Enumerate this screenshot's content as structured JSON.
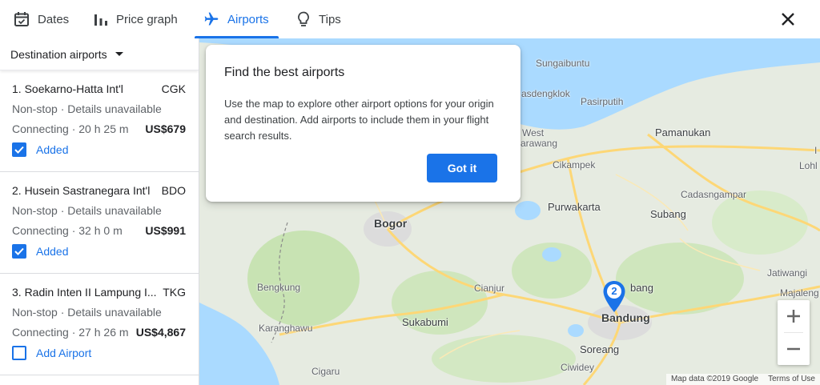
{
  "tabs": [
    {
      "label": "Dates",
      "icon": "calendar-check-icon",
      "active": false
    },
    {
      "label": "Price graph",
      "icon": "bar-chart-icon",
      "active": false
    },
    {
      "label": "Airports",
      "icon": "airplane-icon",
      "active": true
    },
    {
      "label": "Tips",
      "icon": "lightbulb-icon",
      "active": false
    }
  ],
  "sidebar": {
    "dropdown_label": "Destination airports",
    "airports": [
      {
        "name": "1. Soekarno-Hatta Int'l",
        "code": "CGK",
        "nonstop": "Non-stop · Details unavailable",
        "connecting": "Connecting · 20 h 25 m",
        "price": "US$679",
        "status": "Added",
        "checked": true
      },
      {
        "name": "2. Husein Sastranegara Int'l",
        "code": "BDO",
        "nonstop": "Non-stop · Details unavailable",
        "connecting": "Connecting · 32 h 0 m",
        "price": "US$991",
        "status": "Added",
        "checked": true
      },
      {
        "name": "3. Radin Inten II Lampung I...",
        "code": "TKG",
        "nonstop": "Non-stop · Details unavailable",
        "connecting": "Connecting · 27 h 26 m",
        "price": "US$4,867",
        "status": "Add Airport",
        "checked": false
      }
    ]
  },
  "tooltip": {
    "title": "Find the best airports",
    "body": "Use the map to explore other airport options for your origin and destination. Add airports to include them in your flight search results.",
    "button": "Got it"
  },
  "map": {
    "places": {
      "sungaibuntu": "Sungaibuntu",
      "rasdengklok": "asdengklok",
      "pasirputih": "Pasirputih",
      "west_karawang_1": "West",
      "west_karawang_2": "arawang",
      "pamanukan": "Pamanukan",
      "cikampek": "Cikampek",
      "cadasngampar": "Cadasngampar",
      "purwakarta": "Purwakarta",
      "subang": "Subang",
      "bogor": "Bogor",
      "bengkung": "Bengkung",
      "cianjur": "Cianjur",
      "karanghawu": "Karanghawu",
      "sukabumi": "Sukabumi",
      "lembang": "bang",
      "bandung": "Bandung",
      "soreang": "Soreang",
      "ciwidey": "Ciwidey",
      "cigaru": "Cigaru",
      "jatiwangi": "Jatiwangi",
      "majalengka": "Majaleng",
      "lohbener": "Lohl",
      "edge_i": "I"
    },
    "pin_count": "2",
    "zoom_in": "+",
    "zoom_out": "−",
    "attribution": "Map data ©2019 Google",
    "terms": "Terms of Use"
  },
  "colors": {
    "accent": "#1a73e8",
    "water": "#aadaff",
    "land": "#e6ebe1",
    "park": "#c8e3b3",
    "road": "#fdd776"
  }
}
